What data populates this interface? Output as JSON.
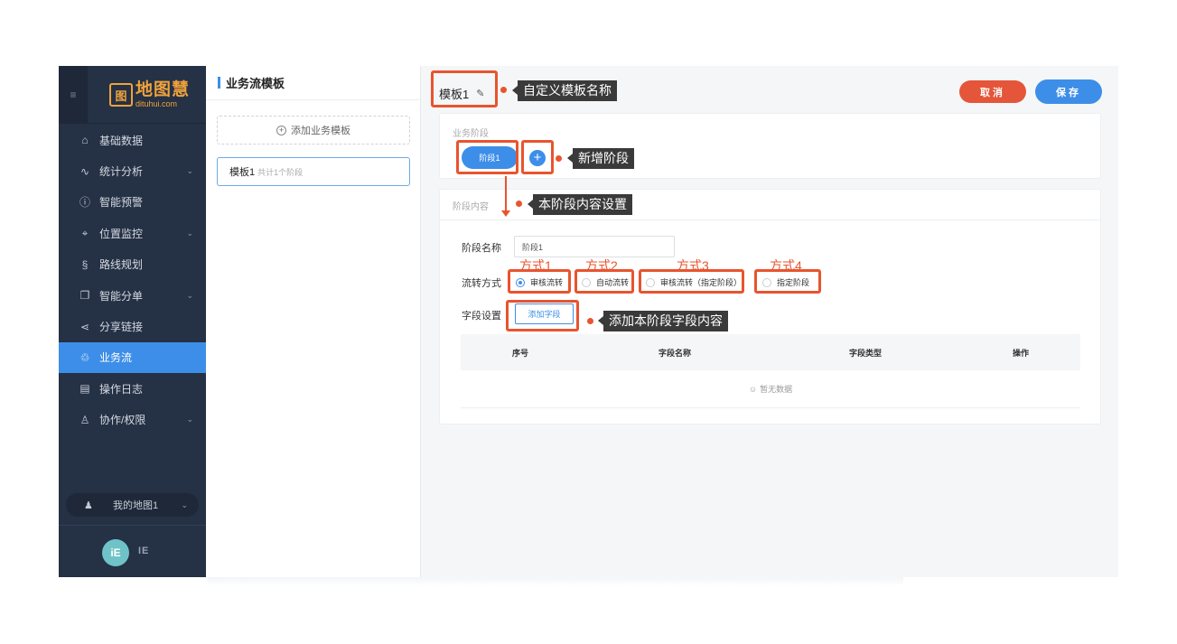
{
  "sidebar": {
    "logo_mark": "图",
    "logo_cn": "地图慧",
    "logo_en": "dituhui.com",
    "collapse_icon": "≡",
    "items": [
      {
        "label": "基础数据",
        "icon": "home-icon",
        "glyph": "⌂",
        "chevron": false
      },
      {
        "label": "统计分析",
        "icon": "pulse-icon",
        "glyph": "∿",
        "chevron": true
      },
      {
        "label": "智能预警",
        "icon": "info-circle-icon",
        "glyph": "ⓘ",
        "chevron": false
      },
      {
        "label": "位置监控",
        "icon": "location-pin-icon",
        "glyph": "⌖",
        "chevron": true
      },
      {
        "label": "路线规划",
        "icon": "route-icon",
        "glyph": "§",
        "chevron": false
      },
      {
        "label": "智能分单",
        "icon": "copy-icon",
        "glyph": "❐",
        "chevron": true
      },
      {
        "label": "分享链接",
        "icon": "share-icon",
        "glyph": "⋖",
        "chevron": false
      },
      {
        "label": "业务流",
        "icon": "workflow-icon",
        "glyph": "♲",
        "chevron": false,
        "active": true
      },
      {
        "label": "操作日志",
        "icon": "clipboard-icon",
        "glyph": "▤",
        "chevron": false
      },
      {
        "label": "协作/权限",
        "icon": "users-icon",
        "glyph": "♙",
        "chevron": true
      }
    ],
    "map_selector": {
      "label": "我的地图1",
      "icon": "user-map-icon",
      "glyph": "♟"
    },
    "avatar_text": "iE",
    "avatar_tag": "IE"
  },
  "templates": {
    "header": "业务流模板",
    "add_label": "添加业务模板",
    "items": [
      {
        "name": "模板1",
        "sub": "共计1个阶段"
      }
    ]
  },
  "main": {
    "template_name": "模板1",
    "cancel_label": "取消",
    "save_label": "保存",
    "stage_section_title": "业务阶段",
    "stages": [
      "阶段1"
    ],
    "content_section_title": "阶段内容",
    "stage_name_label": "阶段名称",
    "stage_name_value": "阶段1",
    "flow_label": "流转方式",
    "flow_options": [
      {
        "label": "审核流转",
        "selected": true
      },
      {
        "label": "自动流转",
        "selected": false
      },
      {
        "label": "审核流转（指定阶段）",
        "selected": false
      },
      {
        "label": "指定阶段",
        "selected": false
      }
    ],
    "field_label": "字段设置",
    "add_field_label": "添加字段",
    "table_headers": [
      "序号",
      "字段名称",
      "字段类型",
      "操作"
    ],
    "empty_text": "暂无数据"
  },
  "annotations": {
    "custom_name": "自定义模板名称",
    "new_stage": "新增阶段",
    "stage_content": "本阶段内容设置",
    "add_field": "添加本阶段字段内容",
    "modes": [
      "方式1",
      "方式2",
      "方式3",
      "方式4"
    ]
  },
  "colors": {
    "accent": "#3d8ee8",
    "danger": "#e4553a",
    "annotation": "#e8542e",
    "sidebar_bg": "#253144"
  }
}
